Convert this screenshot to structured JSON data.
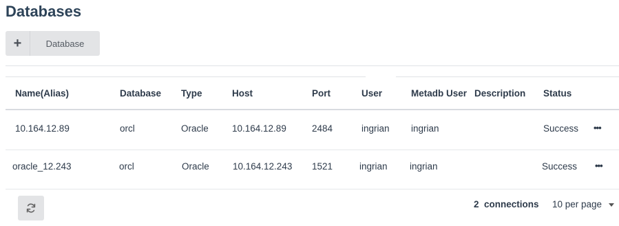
{
  "page": {
    "title": "Databases"
  },
  "toolbar": {
    "add_label": "Database",
    "add_icon": "plus-icon"
  },
  "table": {
    "columns": [
      "Name(Alias)",
      "Database",
      "Type",
      "Host",
      "Port",
      "User",
      "Metadb User",
      "Description",
      "Status"
    ],
    "rows": [
      {
        "name": "10.164.12.89",
        "database": "orcl",
        "type": "Oracle",
        "host": "10.164.12.89",
        "port": "2484",
        "user": "ingrian",
        "metadb_user": "ingrian",
        "description": "",
        "status": "Success",
        "actions_icon": "more-icon"
      },
      {
        "name": "oracle_12.243",
        "database": "orcl",
        "type": "Oracle",
        "host": "10.164.12.243",
        "port": "1521",
        "user": "ingrian",
        "metadb_user": "ingrian",
        "description": "",
        "status": "Success",
        "actions_icon": "more-icon"
      }
    ]
  },
  "footer": {
    "refresh_icon": "refresh-icon",
    "count": "2",
    "count_label": "connections",
    "per_page": "10 per page"
  }
}
